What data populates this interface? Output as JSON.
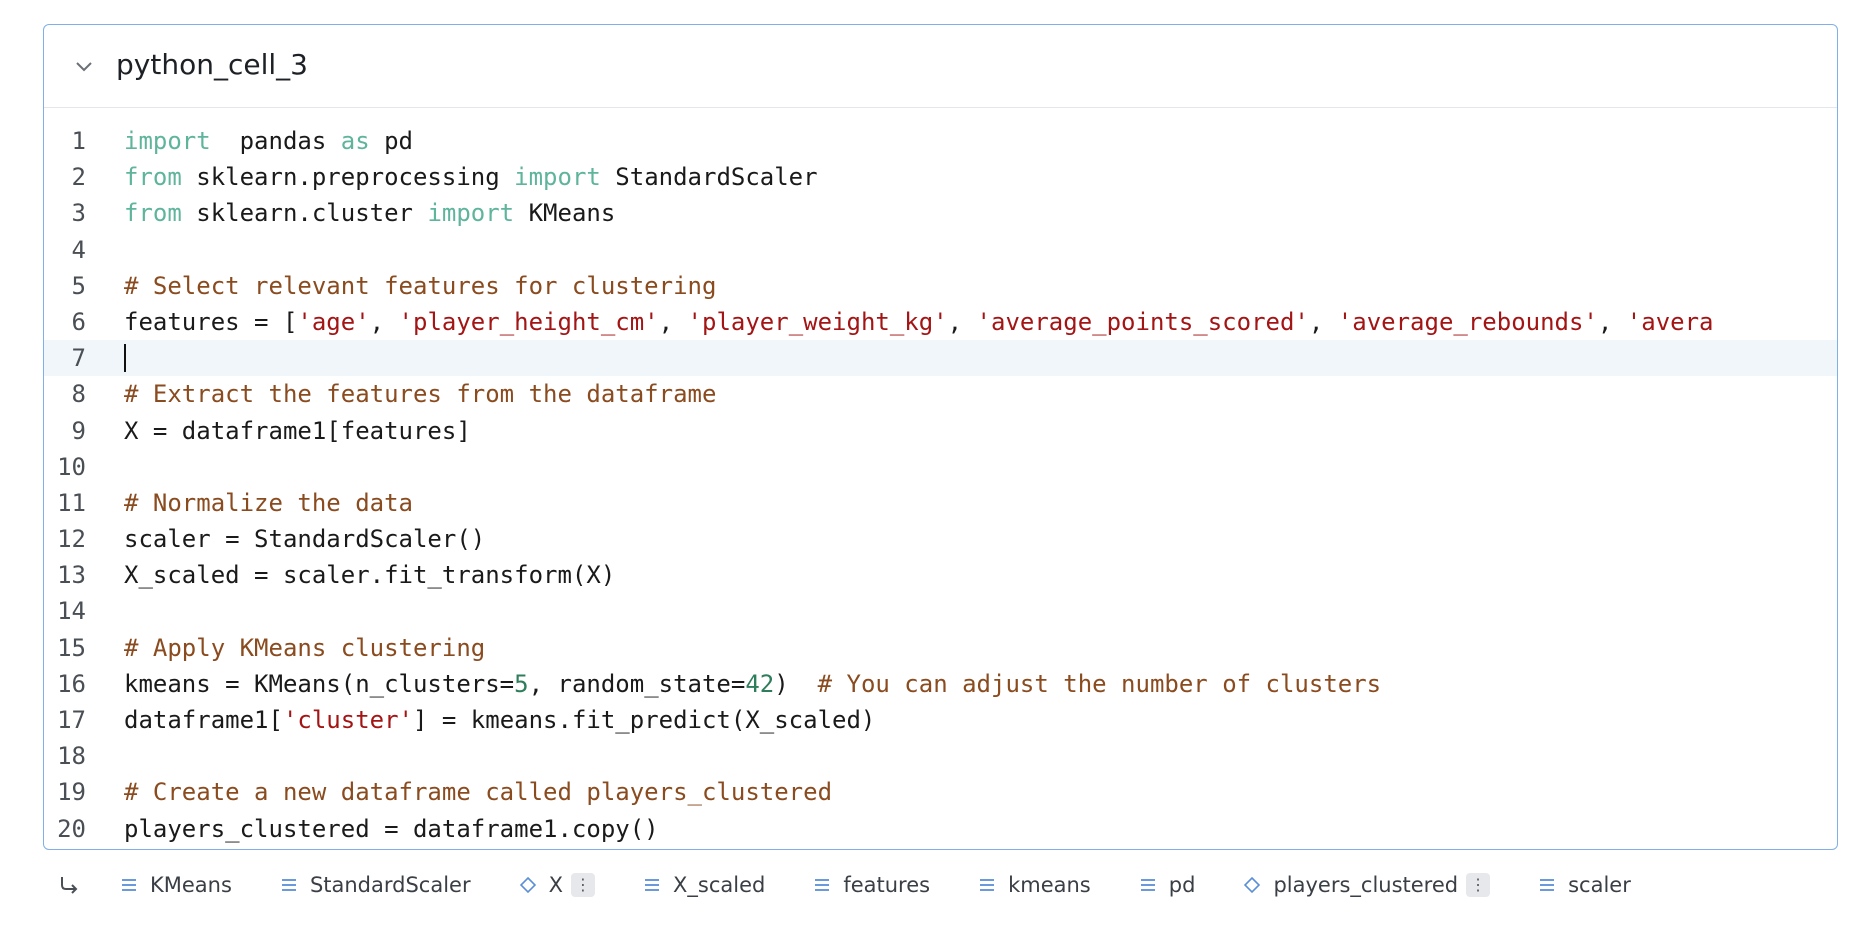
{
  "cell": {
    "title": "python_cell_3",
    "lines": [
      {
        "n": "1",
        "tokens": [
          [
            "kw",
            "import"
          ],
          [
            "",
            "  pandas "
          ],
          [
            "kw",
            "as"
          ],
          [
            "",
            " pd"
          ]
        ]
      },
      {
        "n": "2",
        "tokens": [
          [
            "kw",
            "from"
          ],
          [
            "",
            " sklearn.preprocessing "
          ],
          [
            "kw",
            "import"
          ],
          [
            "",
            " StandardScaler"
          ]
        ]
      },
      {
        "n": "3",
        "tokens": [
          [
            "kw",
            "from"
          ],
          [
            "",
            " sklearn.cluster "
          ],
          [
            "kw",
            "import"
          ],
          [
            "",
            " KMeans"
          ]
        ]
      },
      {
        "n": "4",
        "tokens": []
      },
      {
        "n": "5",
        "tokens": [
          [
            "cm",
            "# Select relevant features for clustering"
          ]
        ]
      },
      {
        "n": "6",
        "tokens": [
          [
            "",
            "features = ["
          ],
          [
            "st",
            "'age'"
          ],
          [
            "",
            ", "
          ],
          [
            "st",
            "'player_height_cm'"
          ],
          [
            "",
            ", "
          ],
          [
            "st",
            "'player_weight_kg'"
          ],
          [
            "",
            ", "
          ],
          [
            "st",
            "'average_points_scored'"
          ],
          [
            "",
            ", "
          ],
          [
            "st",
            "'average_rebounds'"
          ],
          [
            "",
            ", "
          ],
          [
            "st",
            "'avera"
          ]
        ]
      },
      {
        "n": "7",
        "tokens": []
      },
      {
        "n": "8",
        "tokens": [
          [
            "cm",
            "# Extract the features from the dataframe"
          ]
        ]
      },
      {
        "n": "9",
        "tokens": [
          [
            "",
            "X = dataframe1[features]"
          ]
        ]
      },
      {
        "n": "10",
        "tokens": []
      },
      {
        "n": "11",
        "tokens": [
          [
            "cm",
            "# Normalize the data"
          ]
        ]
      },
      {
        "n": "12",
        "tokens": [
          [
            "",
            "scaler = StandardScaler()"
          ]
        ]
      },
      {
        "n": "13",
        "tokens": [
          [
            "",
            "X_scaled = scaler.fit_transform(X)"
          ]
        ]
      },
      {
        "n": "14",
        "tokens": []
      },
      {
        "n": "15",
        "tokens": [
          [
            "cm",
            "# Apply KMeans clustering"
          ]
        ]
      },
      {
        "n": "16",
        "tokens": [
          [
            "",
            "kmeans = KMeans(n_clusters="
          ],
          [
            "nu",
            "5"
          ],
          [
            "",
            ", random_state="
          ],
          [
            "nu",
            "42"
          ],
          [
            "",
            ")  "
          ],
          [
            "cm",
            "# You can adjust the number of clusters"
          ]
        ]
      },
      {
        "n": "17",
        "tokens": [
          [
            "",
            "dataframe1["
          ],
          [
            "st",
            "'cluster'"
          ],
          [
            "",
            "] = kmeans.fit_predict(X_scaled)"
          ]
        ]
      },
      {
        "n": "18",
        "tokens": []
      },
      {
        "n": "19",
        "tokens": [
          [
            "cm",
            "# Create a new dataframe called players_clustered"
          ]
        ]
      },
      {
        "n": "20",
        "tokens": [
          [
            "",
            "players_clustered = dataframe1.copy()"
          ]
        ]
      }
    ]
  },
  "footer": {
    "variables": [
      {
        "name": "KMeans",
        "icon": "list-icon",
        "badge": ""
      },
      {
        "name": "StandardScaler",
        "icon": "list-icon",
        "badge": ""
      },
      {
        "name": "X",
        "icon": "diamond-icon",
        "badge": "⋮"
      },
      {
        "name": "X_scaled",
        "icon": "list-icon",
        "badge": ""
      },
      {
        "name": "features",
        "icon": "list-icon",
        "badge": ""
      },
      {
        "name": "kmeans",
        "icon": "list-icon",
        "badge": ""
      },
      {
        "name": "pd",
        "icon": "list-icon",
        "badge": ""
      },
      {
        "name": "players_clustered",
        "icon": "diamond-icon",
        "badge": "⋮"
      },
      {
        "name": "scaler",
        "icon": "list-icon",
        "badge": ""
      }
    ]
  },
  "colors": {
    "accent": "#7fb0ea",
    "keyword": "#5fb49c",
    "comment": "#8a4b1f",
    "string": "#a31515",
    "number": "#2e7d5b"
  }
}
